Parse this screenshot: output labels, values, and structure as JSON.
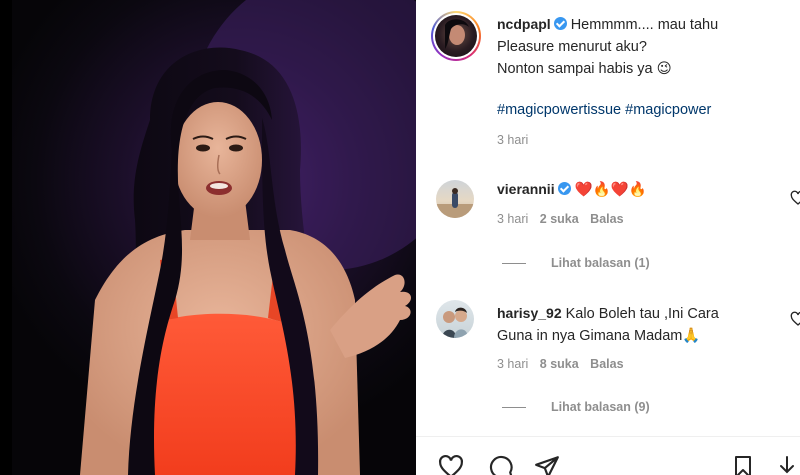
{
  "post": {
    "author": "ncdpapl",
    "caption_lines": [
      "Hemmmm.... mau tahu",
      "Pleasure menurut aku?",
      "Nonton sampai habis ya"
    ],
    "caption_emoji": "😉",
    "hashtags": "#magicpowertissue #magicpower",
    "time": "3 hari"
  },
  "comments": [
    {
      "username": "vierannii",
      "verified": true,
      "text": "❤️🔥❤️🔥",
      "time": "3 hari",
      "likes": "2 suka",
      "reply_label": "Balas",
      "view_replies": "Lihat balasan (1)"
    },
    {
      "username": "harisy_92",
      "verified": false,
      "text_line1": "Kalo Boleh tau ,Ini Cara",
      "text_line2": "Guna in nya Gimana Madam",
      "emoji": "🙏",
      "time": "3 hari",
      "likes": "8 suka",
      "reply_label": "Balas",
      "view_replies": "Lihat balasan (9)"
    }
  ],
  "icons": {
    "like": "heart-icon",
    "comment": "comment-icon",
    "share": "share-icon",
    "save": "bookmark-icon",
    "comment_like": "heart-icon",
    "download": "download-icon"
  },
  "colors": {
    "hashtag": "#00376b",
    "verified": "#3897f0",
    "muted": "#8e8e8e",
    "dress": "#ff4a2a"
  }
}
